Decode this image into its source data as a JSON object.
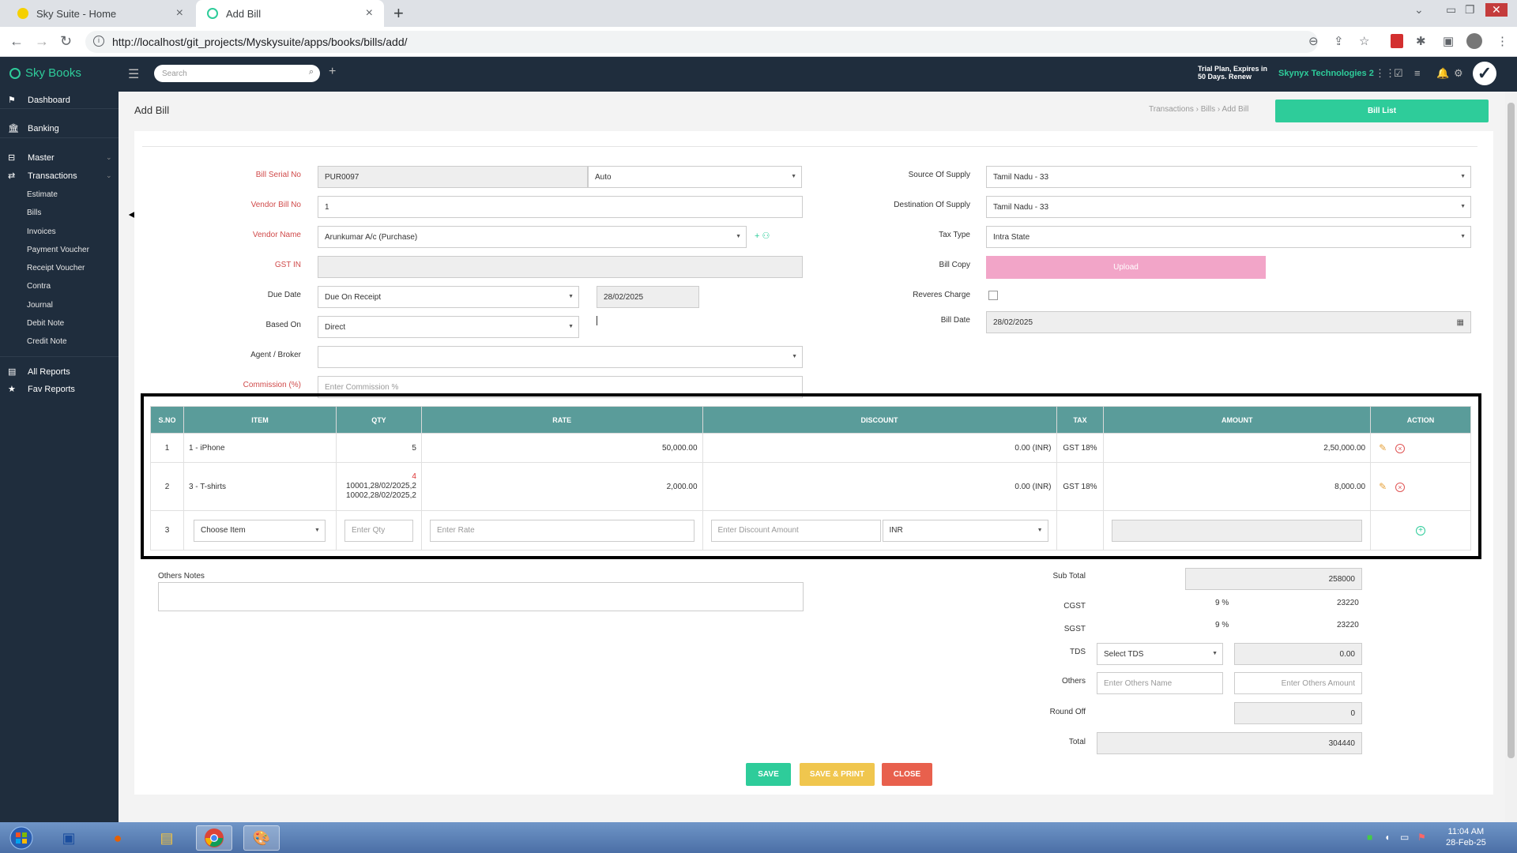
{
  "browser": {
    "tabs": [
      {
        "title": "Sky Suite - Home"
      },
      {
        "title": "Add Bill"
      }
    ],
    "url": "http://localhost/git_projects/Myskysuite/apps/books/bills/add/"
  },
  "app": {
    "brand": "Sky Books",
    "search_placeholder": "Search",
    "trial_line1": "Trial Plan, Expires in",
    "trial_line2": "50 Days. Renew",
    "company": "Skynyx Technologies 2"
  },
  "sidebar": {
    "dashboard": "Dashboard",
    "banking": "Banking",
    "master": "Master",
    "transactions": "Transactions",
    "sub": [
      "Estimate",
      "Bills",
      "Invoices",
      "Payment Voucher",
      "Receipt Voucher",
      "Contra",
      "Journal",
      "Debit Note",
      "Credit Note"
    ],
    "all_reports": "All Reports",
    "fav_reports": "Fav Reports"
  },
  "page": {
    "title": "Add Bill",
    "breadcrumb": [
      "Transactions",
      "Bills",
      "Add Bill"
    ],
    "bill_list_button": "Bill List"
  },
  "form": {
    "bill_serial_label": "Bill Serial No",
    "bill_serial_value": "PUR0097",
    "bill_serial_mode": "Auto",
    "vendor_bill_label": "Vendor Bill No",
    "vendor_bill_value": "1",
    "vendor_name_label": "Vendor Name",
    "vendor_name_value": "Arunkumar A/c (Purchase)",
    "gstin_label": "GST IN",
    "gstin_value": "",
    "due_date_label": "Due Date",
    "due_date_term": "Due On Receipt",
    "due_date_value": "28/02/2025",
    "based_on_label": "Based On",
    "based_on_value": "Direct",
    "agent_label": "Agent / Broker",
    "agent_value": "",
    "commission_label": "Commission (%)",
    "commission_placeholder": "Enter Commission %",
    "source_label": "Source Of Supply",
    "source_value": "Tamil Nadu - 33",
    "dest_label": "Destination Of Supply",
    "dest_value": "Tamil Nadu - 33",
    "tax_type_label": "Tax Type",
    "tax_type_value": "Intra State",
    "bill_copy_label": "Bill Copy",
    "upload_label": "Upload",
    "reverse_charge_label": "Reveres Charge",
    "bill_date_label": "Bill Date",
    "bill_date_value": "28/02/2025"
  },
  "table": {
    "headers": [
      "S.NO",
      "ITEM",
      "QTY",
      "RATE",
      "DISCOUNT",
      "TAX",
      "AMOUNT",
      "ACTION"
    ],
    "rows": [
      {
        "sno": "1",
        "item": "1 - iPhone",
        "qty": "5",
        "qty_extra1": "",
        "qty_extra2": "",
        "rate": "50,000.00",
        "discount": "0.00 (INR)",
        "tax": "GST 18%",
        "amount": "2,50,000.00"
      },
      {
        "sno": "2",
        "item": "3 - T-shirts",
        "qty": "4",
        "qty_extra1": "10001,28/02/2025,2",
        "qty_extra2": "10002,28/02/2025,2",
        "rate": "2,000.00",
        "discount": "0.00 (INR)",
        "tax": "GST 18%",
        "amount": "8,000.00"
      }
    ],
    "new_row": {
      "sno": "3",
      "item_placeholder": "Choose Item",
      "qty_placeholder": "Enter Qty",
      "rate_placeholder": "Enter Rate",
      "discount_placeholder": "Enter Discount Amount",
      "currency": "INR"
    }
  },
  "totals": {
    "notes_label": "Others Notes",
    "sub_total_label": "Sub Total",
    "sub_total": "258000",
    "cgst_label": "CGST",
    "cgst_rate": "9 %",
    "cgst": "23220",
    "sgst_label": "SGST",
    "sgst_rate": "9 %",
    "sgst": "23220",
    "tds_label": "TDS",
    "tds_select": "Select TDS",
    "tds_value": "0.00",
    "others_label": "Others",
    "others_name_placeholder": "Enter Others Name",
    "others_amount_placeholder": "Enter Others Amount",
    "round_off_label": "Round Off",
    "round_off": "0",
    "total_label": "Total",
    "total": "304440"
  },
  "buttons": {
    "save": "SAVE",
    "save_print": "SAVE & PRINT",
    "close": "CLOSE"
  },
  "taskbar": {
    "time": "11:04 AM",
    "date": "28-Feb-25"
  },
  "colors": {
    "accent": "#2ecc9a",
    "sidebar": "#1f2d3d",
    "table_header": "#5a9c9a",
    "upload": "#f2a5c8"
  }
}
